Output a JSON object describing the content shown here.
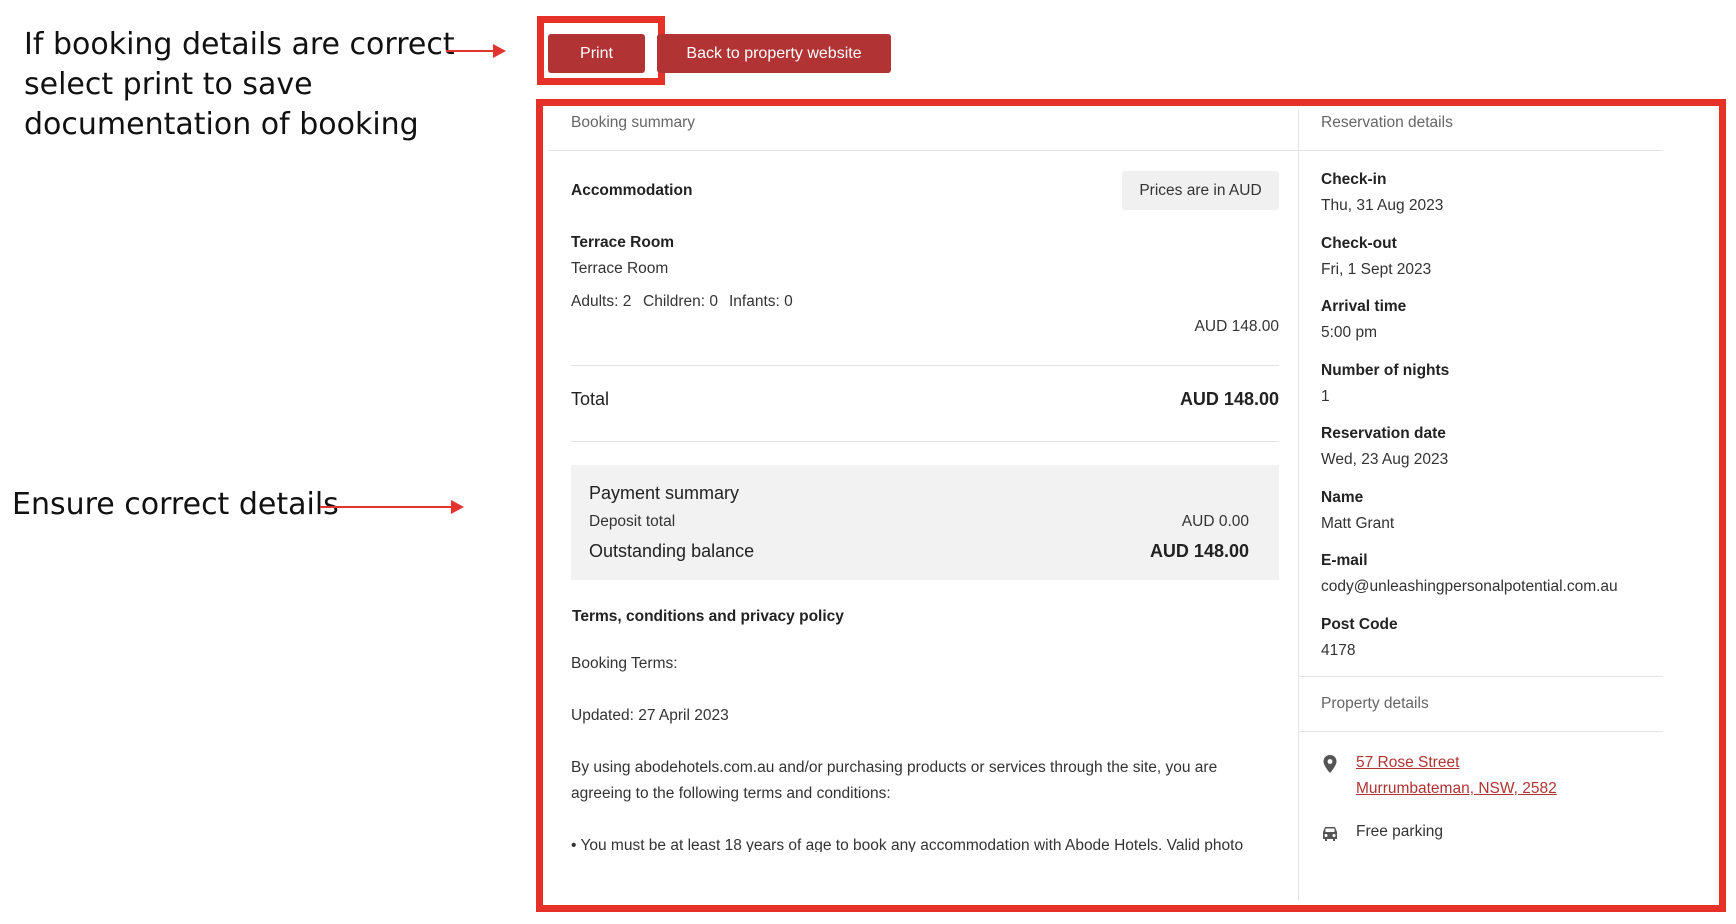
{
  "annotations": {
    "top_lines": [
      "If booking details are correct",
      "select print to save",
      "documentation of booking"
    ],
    "middle": "Ensure correct details"
  },
  "toolbar": {
    "print_label": "Print",
    "back_label": "Back to property website"
  },
  "booking": {
    "section_title": "Booking summary",
    "accommodation_label": "Accommodation",
    "currency_note": "Prices are in AUD",
    "room_name": "Terrace Room",
    "room_type": "Terrace Room",
    "guests": {
      "adults": "Adults: 2",
      "children": "Children: 0",
      "infants": "Infants: 0"
    },
    "room_price": "AUD 148.00",
    "total_label": "Total",
    "total_value": "AUD 148.00",
    "payment": {
      "title": "Payment summary",
      "deposit_label": "Deposit total",
      "deposit_value": "AUD 0.00",
      "outstanding_label": "Outstanding balance",
      "outstanding_value": "AUD 148.00"
    },
    "terms": {
      "title": "Terms, conditions and privacy policy",
      "booking_terms": "Booking Terms:",
      "updated": "Updated: 27 April 2023",
      "para1_line1": "By using abodehotels.com.au and/or purchasing products or services through the site, you are",
      "para1_line2": "agreeing to the following terms and conditions:",
      "bullet1": "• You must be at least 18 years of age to book any accommodation with Abode Hotels. Valid photo"
    }
  },
  "reservation": {
    "section_title": "Reservation details",
    "checkin_label": "Check-in",
    "checkin_value": "Thu, 31 Aug 2023",
    "checkout_label": "Check-out",
    "checkout_value": "Fri, 1 Sept 2023",
    "arrival_label": "Arrival time",
    "arrival_value": "5:00 pm",
    "nights_label": "Number of nights",
    "nights_value": "1",
    "resdate_label": "Reservation date",
    "resdate_value": "Wed, 23 Aug 2023",
    "name_label": "Name",
    "name_value": "Matt Grant",
    "email_label": "E-mail",
    "email_value": "cody@unleashingpersonalpotential.com.au",
    "postcode_label": "Post Code",
    "postcode_value": "4178"
  },
  "property": {
    "section_title": "Property details",
    "address_line1": "57 Rose Street",
    "address_line2": "Murrumbateman, NSW, 2582",
    "parking": "Free parking",
    "icons": {
      "location": "map-pin-icon",
      "parking": "car-icon"
    }
  },
  "colors": {
    "accent": "#b13333",
    "annotation_red": "#e53127"
  }
}
